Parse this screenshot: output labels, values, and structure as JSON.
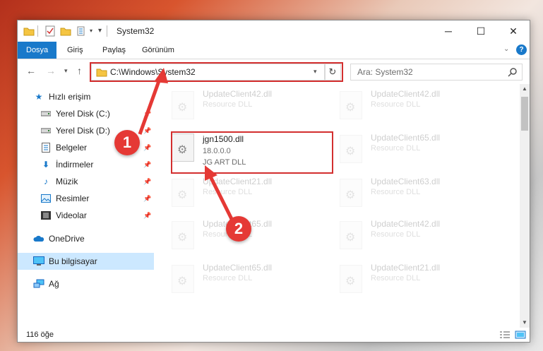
{
  "window": {
    "title": "System32",
    "controls": {
      "minimize": "─",
      "maximize": "☐",
      "close": "✕"
    }
  },
  "ribbon": {
    "tabs": [
      "Dosya",
      "Giriş",
      "Paylaş",
      "Görünüm"
    ],
    "help": "?"
  },
  "address": {
    "path": "C:\\Windows\\System32",
    "search_placeholder": "Ara: System32"
  },
  "nav": {
    "items": [
      {
        "label": "Hızlı erişim",
        "icon": "star-icon",
        "pinned": false
      },
      {
        "label": "Yerel Disk (C:)",
        "icon": "drive-icon",
        "pinned": true
      },
      {
        "label": "Yerel Disk (D:)",
        "icon": "drive-icon",
        "pinned": true
      },
      {
        "label": "Belgeler",
        "icon": "documents-icon",
        "pinned": true
      },
      {
        "label": "İndirmeler",
        "icon": "download-icon",
        "pinned": true
      },
      {
        "label": "Müzik",
        "icon": "music-icon",
        "pinned": true
      },
      {
        "label": "Resimler",
        "icon": "pictures-icon",
        "pinned": true
      },
      {
        "label": "Videolar",
        "icon": "videos-icon",
        "pinned": true
      },
      {
        "label": "OneDrive",
        "icon": "cloud-icon",
        "pinned": false
      },
      {
        "label": "Bu bilgisayar",
        "icon": "computer-icon",
        "pinned": false
      },
      {
        "label": "Ağ",
        "icon": "network-icon",
        "pinned": false
      }
    ]
  },
  "files": {
    "left_column": [
      {
        "name": "UpdateClient42.dll",
        "line2": "Resource DLL"
      },
      {
        "name": "jgn1500.dll",
        "line2": "18.0.0.0",
        "line3": "JG ART DLL"
      },
      {
        "name": "UpdateClient21.dll",
        "line2": "Resource DLL"
      },
      {
        "name": "UpdateClient65.dll",
        "line2": "Resource DLL"
      },
      {
        "name": "UpdateClient65.dll",
        "line2": "Resource DLL"
      }
    ],
    "right_column": [
      {
        "name": "UpdateClient42.dll",
        "line2": "Resource DLL"
      },
      {
        "name": "UpdateClient65.dll",
        "line2": "Resource DLL"
      },
      {
        "name": "UpdateClient63.dll",
        "line2": "Resource DLL"
      },
      {
        "name": "UpdateClient42.dll",
        "line2": "Resource DLL"
      },
      {
        "name": "UpdateClient21.dll",
        "line2": "Resource DLL"
      }
    ]
  },
  "status": {
    "count": "116 öğe"
  },
  "annotations": {
    "step1": "1",
    "step2": "2"
  },
  "colors": {
    "ribbon_active": "#1979ca",
    "highlight_red": "#d32f2f",
    "badge_red": "#e53935",
    "selected_nav": "#cce8ff"
  }
}
